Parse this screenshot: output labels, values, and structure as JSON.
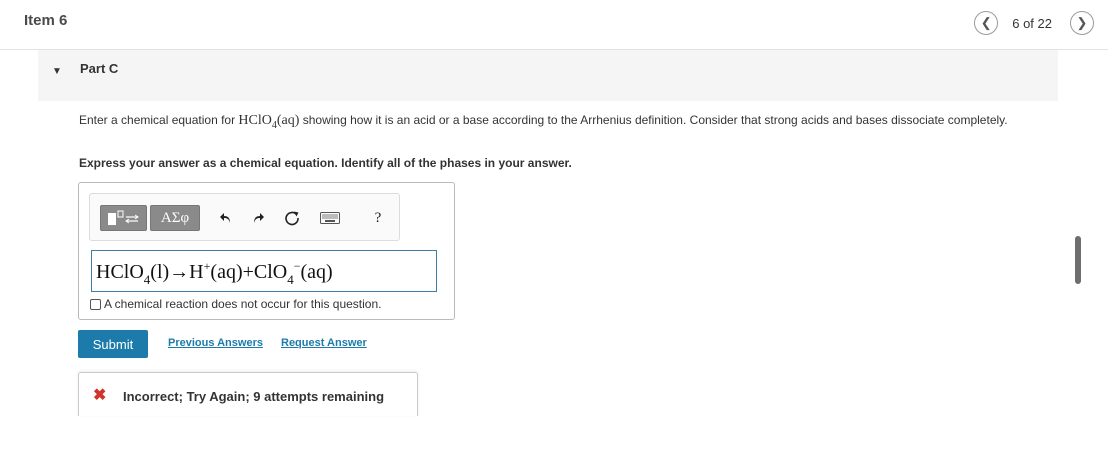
{
  "header": {
    "item_title": "Item 6",
    "page_indicator": "6 of 22",
    "prev_icon": "chevron-left-icon",
    "next_icon": "chevron-right-icon"
  },
  "part": {
    "title": "Part C",
    "expanded": true
  },
  "question": {
    "prompt_before": "Enter a chemical equation for ",
    "prompt_formula": "HClO4(aq)",
    "prompt_after": " showing how it is an acid or a base according to the Arrhenius definition. Consider that strong acids and bases dissociate completely.",
    "instruction": "Express your answer as a chemical equation. Identify all of the phases in your answer."
  },
  "toolbar": {
    "greek_label": "ΑΣφ",
    "help_label": "?",
    "icons": [
      "templates-icon",
      "greek-symbols-icon",
      "undo-icon",
      "redo-icon",
      "reset-icon",
      "keyboard-icon",
      "help-icon"
    ]
  },
  "answer": {
    "display": "HClO4(l)→H+(aq)+ClO4−(aq)",
    "no_reaction_label": "A chemical reaction does not occur for this question.",
    "no_reaction_checked": false
  },
  "actions": {
    "submit": "Submit",
    "previous_answers": "Previous Answers",
    "request_answer": "Request Answer"
  },
  "feedback": {
    "icon": "x-mark-icon",
    "color": "#d0342c",
    "message": "Incorrect; Try Again; 9 attempts remaining"
  },
  "colors": {
    "accent": "#1c7bab",
    "error": "#d0342c",
    "part_bar": "#f5f5f5"
  }
}
